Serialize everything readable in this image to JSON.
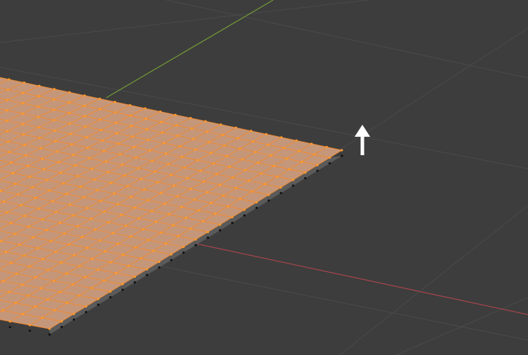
{
  "viewport": {
    "mode": "edit-mode",
    "background_color": "#3d3d3d",
    "grid_line_color": "#4a4a4a",
    "x_axis_color": "#a0444b",
    "y_axis_color": "#6f9437"
  },
  "mesh": {
    "type": "subdivided-plane",
    "face_color": "#c5977a",
    "edge_color": "#f2892b",
    "vertex_color": "#ff9a2a",
    "side_color": "#5a5a5a",
    "unselected_vertex_color": "#111111"
  },
  "gizmo": {
    "icon": "move-up-arrow-icon",
    "color": "#ffffff"
  }
}
